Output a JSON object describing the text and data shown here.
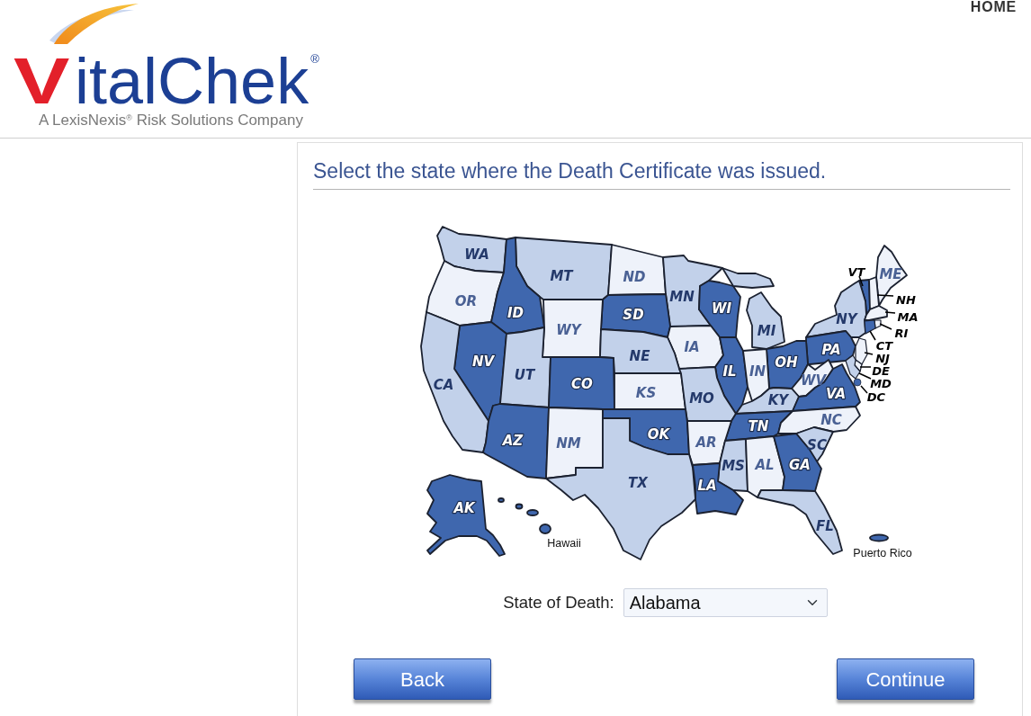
{
  "header": {
    "logo": {
      "initial": "V",
      "wordmark_rest": "italChek",
      "registered": "®",
      "tagline": "A LexisNexis$^{®}$ Risk Solutions Company"
    },
    "nav_links": [
      "HOME"
    ]
  },
  "page": {
    "title": "Select the state where the Death Certificate was issued."
  },
  "map": {
    "states": [
      {
        "label": "WA",
        "color": "#c2d1ea",
        "kind": "inner"
      },
      {
        "label": "MT",
        "color": "#c2d1ea",
        "kind": "inner"
      },
      {
        "label": "ND",
        "color": "#eef2fa",
        "kind": "inner"
      },
      {
        "label": "VT",
        "color": "#3f67ae",
        "kind": "callout"
      },
      {
        "label": "ME",
        "color": "#eef2fa",
        "kind": "inner"
      },
      {
        "label": "OR",
        "color": "#eef2fa",
        "kind": "inner"
      },
      {
        "label": "MN",
        "color": "#c2d1ea",
        "kind": "inner"
      },
      {
        "label": "NH",
        "color": "#eef2fa",
        "kind": "callout"
      },
      {
        "label": "ID",
        "color": "#3f67ae",
        "kind": "inner"
      },
      {
        "label": "SD",
        "color": "#3f67ae",
        "kind": "inner"
      },
      {
        "label": "WI",
        "color": "#3f67ae",
        "kind": "inner"
      },
      {
        "label": "NY",
        "color": "#c2d1ea",
        "kind": "inner"
      },
      {
        "label": "MA",
        "color": "#eef2fa",
        "kind": "callout"
      },
      {
        "label": "WY",
        "color": "#eef2fa",
        "kind": "inner"
      },
      {
        "label": "MI",
        "color": "#c2d1ea",
        "kind": "inner"
      },
      {
        "label": "RI",
        "color": "#eef2fa",
        "kind": "callout"
      },
      {
        "label": "IA",
        "color": "#eef2fa",
        "kind": "inner"
      },
      {
        "label": "PA",
        "color": "#3f67ae",
        "kind": "inner"
      },
      {
        "label": "CT",
        "color": "#3f67ae",
        "kind": "callout"
      },
      {
        "label": "NV",
        "color": "#3f67ae",
        "kind": "inner"
      },
      {
        "label": "NE",
        "color": "#c2d1ea",
        "kind": "inner"
      },
      {
        "label": "OH",
        "color": "#3f67ae",
        "kind": "inner"
      },
      {
        "label": "NJ",
        "color": "#eef2fa",
        "kind": "callout"
      },
      {
        "label": "UT",
        "color": "#c2d1ea",
        "kind": "inner"
      },
      {
        "label": "IL",
        "color": "#3f67ae",
        "kind": "inner"
      },
      {
        "label": "IN",
        "color": "#eef2fa",
        "kind": "inner"
      },
      {
        "label": "DE",
        "color": "#eef2fa",
        "kind": "callout"
      },
      {
        "label": "CA",
        "color": "#c2d1ea",
        "kind": "inner"
      },
      {
        "label": "CO",
        "color": "#3f67ae",
        "kind": "inner"
      },
      {
        "label": "WV",
        "color": "#eef2fa",
        "kind": "inner"
      },
      {
        "label": "MD",
        "color": "#c2d1ea",
        "kind": "callout"
      },
      {
        "label": "KS",
        "color": "#eef2fa",
        "kind": "inner"
      },
      {
        "label": "MO",
        "color": "#c2d1ea",
        "kind": "inner"
      },
      {
        "label": "KY",
        "color": "#c2d1ea",
        "kind": "inner"
      },
      {
        "label": "VA",
        "color": "#3f67ae",
        "kind": "inner"
      },
      {
        "label": "DC",
        "color": "#3f67ae",
        "kind": "callout"
      },
      {
        "label": "TN",
        "color": "#3f67ae",
        "kind": "inner"
      },
      {
        "label": "NC",
        "color": "#eef2fa",
        "kind": "inner"
      },
      {
        "label": "AZ",
        "color": "#3f67ae",
        "kind": "inner"
      },
      {
        "label": "NM",
        "color": "#eef2fa",
        "kind": "inner"
      },
      {
        "label": "OK",
        "color": "#3f67ae",
        "kind": "inner"
      },
      {
        "label": "AR",
        "color": "#eef2fa",
        "kind": "inner"
      },
      {
        "label": "SC",
        "color": "#c2d1ea",
        "kind": "inner"
      },
      {
        "label": "MS",
        "color": "#c2d1ea",
        "kind": "inner"
      },
      {
        "label": "AL",
        "color": "#eef2fa",
        "kind": "inner"
      },
      {
        "label": "GA",
        "color": "#3f67ae",
        "kind": "inner"
      },
      {
        "label": "TX",
        "color": "#c2d1ea",
        "kind": "inner"
      },
      {
        "label": "LA",
        "color": "#3f67ae",
        "kind": "inner"
      },
      {
        "label": "AK",
        "color": "#3f67ae",
        "kind": "inner"
      },
      {
        "label": "FL",
        "color": "#c2d1ea",
        "kind": "inner"
      },
      {
        "label": "Hawaii",
        "color": "#3f67ae",
        "kind": "caption"
      },
      {
        "label": "Puerto Rico",
        "color": "#3f67ae",
        "kind": "caption"
      }
    ]
  },
  "state_select": {
    "label": "State of Death:",
    "value": "Alabama"
  },
  "buttons": [
    {
      "label": "Back"
    },
    {
      "label": "Continue"
    }
  ]
}
